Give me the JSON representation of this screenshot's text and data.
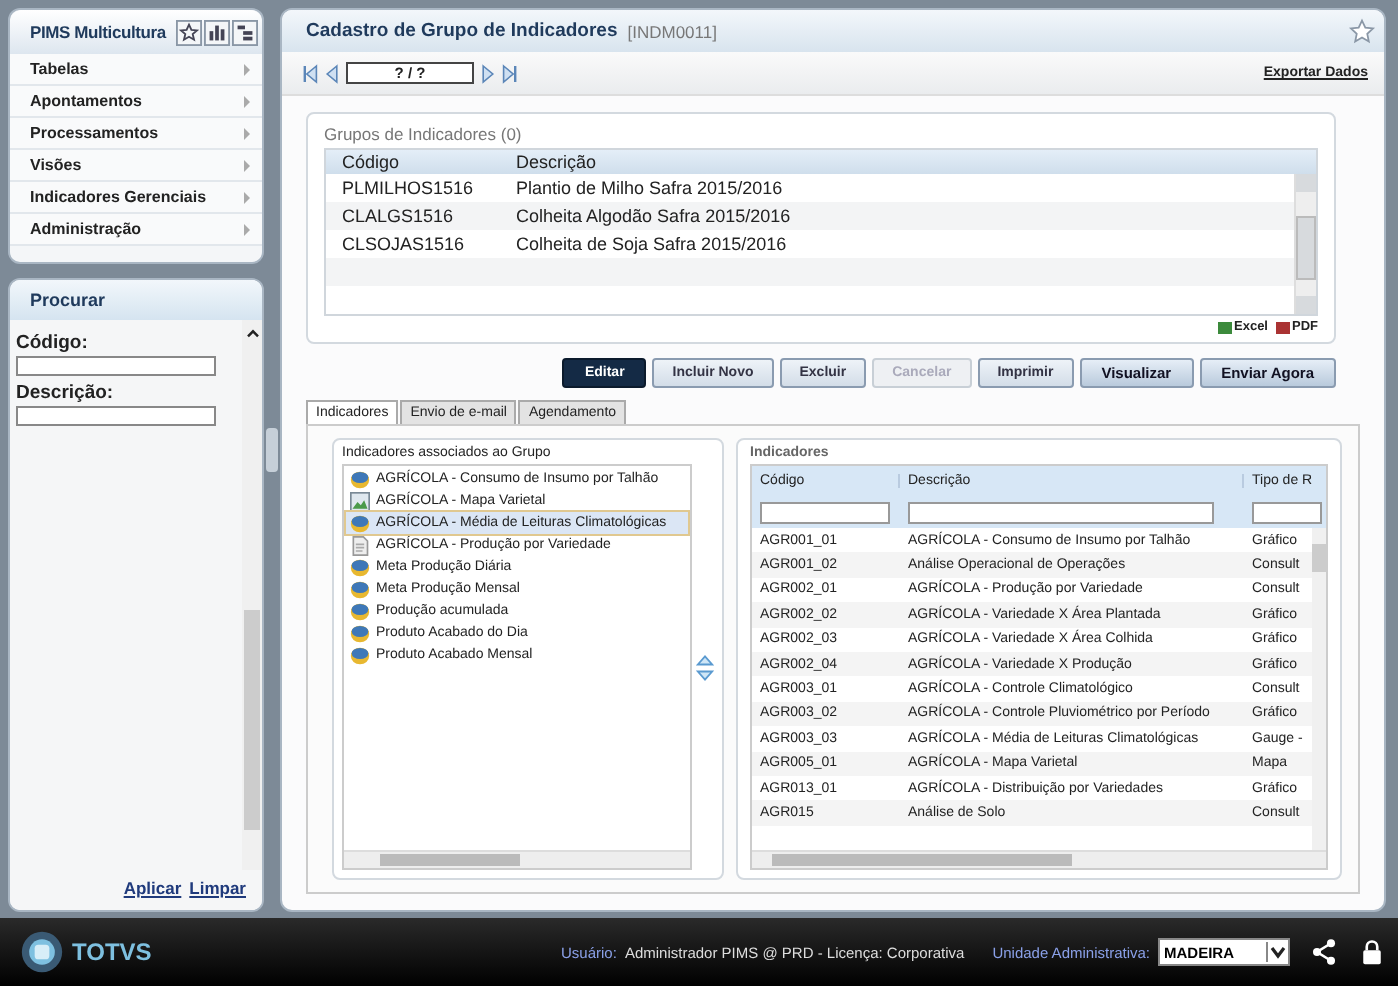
{
  "sidebar": {
    "title": "PIMS Multicultura",
    "menu": [
      {
        "label": "Tabelas"
      },
      {
        "label": "Apontamentos"
      },
      {
        "label": "Processamentos"
      },
      {
        "label": "Visões"
      },
      {
        "label": "Indicadores Gerenciais"
      },
      {
        "label": "Administração"
      }
    ],
    "search": {
      "title": "Procurar",
      "fields": [
        {
          "label": "Código:"
        },
        {
          "label": "Descrição:"
        }
      ],
      "links": [
        "Aplicar",
        "Limpar"
      ]
    }
  },
  "main": {
    "title": "Cadastro de Grupo de Indicadores",
    "code": "[INDM0011]",
    "record": "? / ?",
    "export": "Exportar Dados",
    "groups": {
      "title": "Grupos de Indicadores (0)",
      "columns": [
        "Código",
        "Descrição"
      ],
      "rows": [
        [
          "PLMILHOS1516",
          "Plantio de Milho Safra 2015/2016"
        ],
        [
          "CLALGS1516",
          "Colheita Algodão Safra 2015/2016"
        ],
        [
          "CLSOJAS1516",
          "Colheita de Soja Safra 2015/2016"
        ]
      ],
      "exports": [
        "Excel",
        "PDF"
      ]
    },
    "buttons": [
      {
        "label": "Editar",
        "kind": "primary",
        "disabled": false
      },
      {
        "label": "Incluir Novo",
        "kind": "secondary",
        "disabled": false
      },
      {
        "label": "Excluir",
        "kind": "secondary",
        "disabled": false
      },
      {
        "label": "Cancelar",
        "kind": "secondary",
        "disabled": true
      },
      {
        "label": "Imprimir",
        "kind": "secondary",
        "disabled": false
      },
      {
        "label": "Visualizar",
        "kind": "action",
        "disabled": false
      },
      {
        "label": "Enviar Agora",
        "kind": "action",
        "disabled": false
      }
    ],
    "tabs": [
      {
        "label": "Indicadores",
        "selected": true
      },
      {
        "label": "Envio de e-mail",
        "selected": false
      },
      {
        "label": "Agendamento",
        "selected": false
      }
    ],
    "associated": {
      "title": "Indicadores associados ao Grupo",
      "items": [
        {
          "label": "AGRÍCOLA - Consumo de Insumo por Talhão",
          "kind": "chart",
          "selected": false
        },
        {
          "label": "AGRÍCOLA - Mapa Varietal",
          "kind": "map",
          "selected": false
        },
        {
          "label": "AGRÍCOLA - Média de Leituras Climatológicas",
          "kind": "chart",
          "selected": true
        },
        {
          "label": "AGRÍCOLA - Produção por Variedade",
          "kind": "report",
          "selected": false
        },
        {
          "label": "Meta Produção Diária",
          "kind": "chart",
          "selected": false
        },
        {
          "label": "Meta Produção Mensal",
          "kind": "chart",
          "selected": false
        },
        {
          "label": "Produção acumulada",
          "kind": "chart",
          "selected": false
        },
        {
          "label": "Produto Acabado do Dia",
          "kind": "chart",
          "selected": false
        },
        {
          "label": "Produto Acabado Mensal",
          "kind": "chart",
          "selected": false
        }
      ]
    },
    "indicators": {
      "title": "Indicadores",
      "columns": [
        "Código",
        "Descrição",
        "Tipo de R"
      ],
      "rows": [
        [
          "AGR001_01",
          "AGRÍCOLA - Consumo de Insumo por Talhão",
          "Gráfico"
        ],
        [
          "AGR001_02",
          "Análise Operacional de Operações",
          "Consult"
        ],
        [
          "AGR002_01",
          "AGRÍCOLA - Produção por Variedade",
          "Consult"
        ],
        [
          "AGR002_02",
          "AGRÍCOLA - Variedade X Área Plantada",
          "Gráfico"
        ],
        [
          "AGR002_03",
          "AGRÍCOLA - Variedade X Área Colhida",
          "Gráfico"
        ],
        [
          "AGR002_04",
          "AGRÍCOLA - Variedade X Produção",
          "Gráfico"
        ],
        [
          "AGR003_01",
          "AGRÍCOLA - Controle Climatológico",
          "Consult"
        ],
        [
          "AGR003_02",
          "AGRÍCOLA - Controle Pluviométrico por Período",
          "Gráfico"
        ],
        [
          "AGR003_03",
          "AGRÍCOLA - Média de Leituras Climatológicas",
          "Gauge -"
        ],
        [
          "AGR005_01",
          "AGRÍCOLA - Mapa Varietal",
          "Mapa"
        ],
        [
          "AGR013_01",
          "AGRÍCOLA - Distribuição por Variedades",
          "Gráfico"
        ],
        [
          "AGR015",
          "Análise de Solo",
          "Consult"
        ]
      ]
    }
  },
  "status_bar": {
    "brand": "TOTVS",
    "user_label": "Usuário:",
    "user": "Administrador PIMS @ PRD - Licença: Corporativa",
    "unit_label": "Unidade Administrativa:",
    "unit": "MADEIRA"
  }
}
